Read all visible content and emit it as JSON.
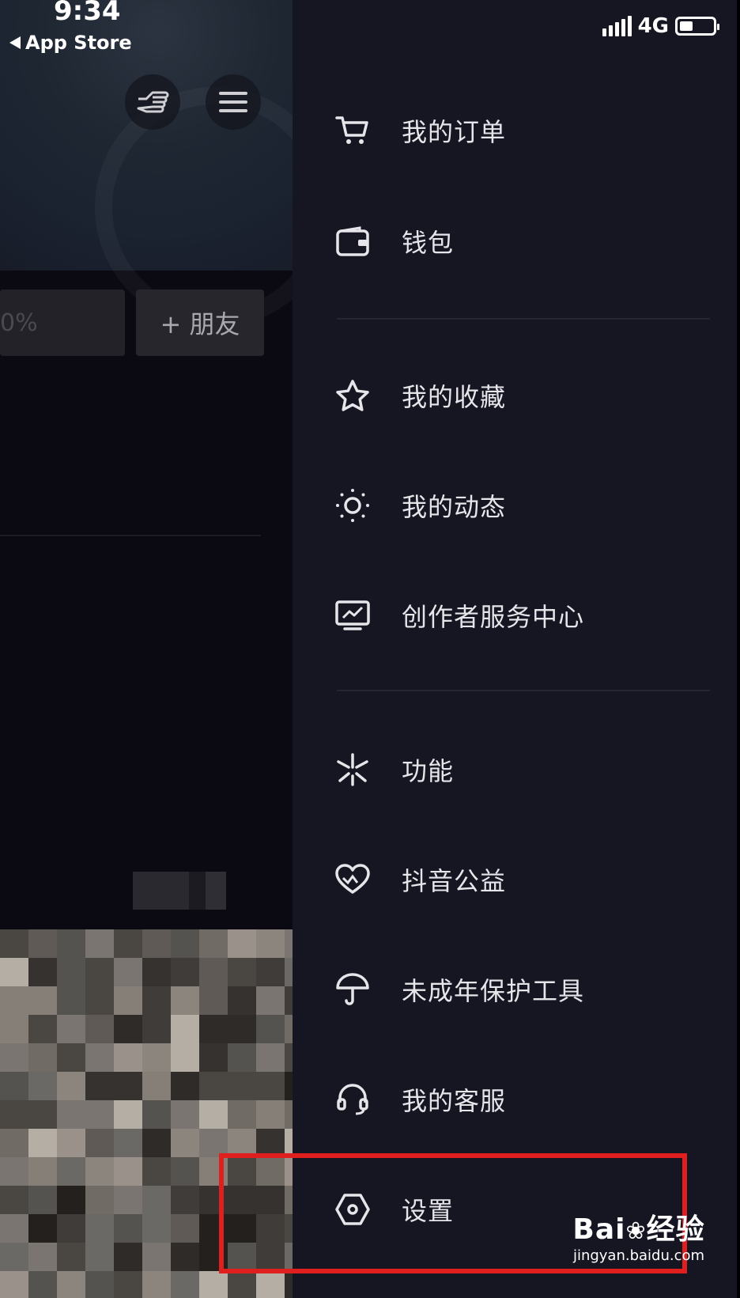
{
  "status_bar": {
    "time": "9:34",
    "back_label": "App Store",
    "network": "4G"
  },
  "profile": {
    "stat_partial": "0%",
    "add_friend_label": "+ 朋友"
  },
  "menu": {
    "items": [
      {
        "id": "orders",
        "label": "我的订单",
        "icon": "cart-icon"
      },
      {
        "id": "wallet",
        "label": "钱包",
        "icon": "wallet-icon"
      },
      {
        "id": "favorites",
        "label": "我的收藏",
        "icon": "star-icon"
      },
      {
        "id": "activity",
        "label": "我的动态",
        "icon": "sun-icon"
      },
      {
        "id": "creator",
        "label": "创作者服务中心",
        "icon": "chart-monitor-icon"
      },
      {
        "id": "features",
        "label": "功能",
        "icon": "sparkle-icon"
      },
      {
        "id": "charity",
        "label": "抖音公益",
        "icon": "heart-icon"
      },
      {
        "id": "minor",
        "label": "未成年保护工具",
        "icon": "umbrella-icon"
      },
      {
        "id": "service",
        "label": "我的客服",
        "icon": "headset-icon"
      },
      {
        "id": "settings",
        "label": "设置",
        "icon": "hexagon-settings-icon"
      }
    ]
  },
  "watermark": {
    "brand": "Bai",
    "brand_suffix": "经验",
    "url": "jingyan.baidu.com"
  },
  "colors": {
    "drawer_bg": "#161622",
    "highlight": "#e0201e",
    "text": "#e6e5ea"
  }
}
